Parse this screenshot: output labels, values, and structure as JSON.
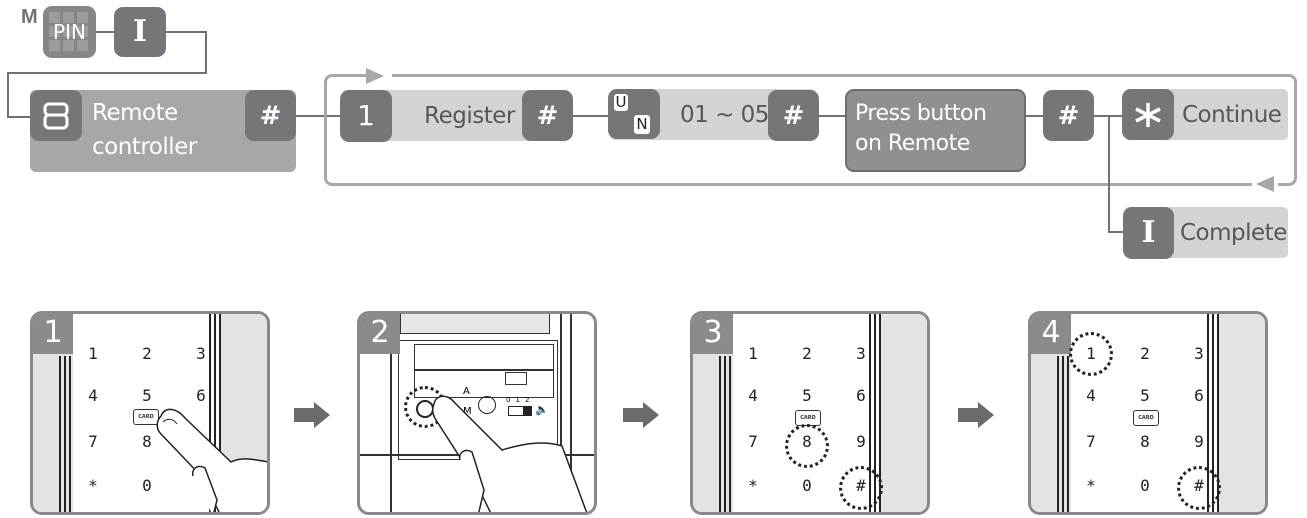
{
  "flow": {
    "mode_label": "M",
    "start_keys": {
      "pin_label": "PIN",
      "confirm_icon": "I"
    },
    "remote_step": {
      "key_label": "8",
      "label_line1": "Remote",
      "label_line2": "controller",
      "confirm_icon": "#"
    },
    "loop_steps": [
      {
        "key_label": "1",
        "label": "Register",
        "confirm_icon": "#"
      },
      {
        "key_top": "U",
        "key_bottom": "N",
        "label": "01 ~ 05",
        "confirm_icon": "#"
      },
      {
        "label_line1": "Press button",
        "label_line2": "on  Remote",
        "confirm_icon": "#"
      }
    ],
    "branches": [
      {
        "key_icon": "*",
        "label": "Continue"
      },
      {
        "key_icon": "I",
        "label": "Complete"
      }
    ]
  },
  "steps": [
    {
      "number": "1",
      "card_label": "CARD"
    },
    {
      "number": "2",
      "switch_labels": [
        "0",
        "1",
        "2"
      ],
      "am_top": "A",
      "am_bottom": "M"
    },
    {
      "number": "3",
      "card_label": "CARD"
    },
    {
      "number": "4",
      "card_label": "CARD"
    }
  ],
  "keypad": {
    "keys": [
      "1",
      "2",
      "3",
      "4",
      "5",
      "6",
      "7",
      "8",
      "9",
      "*",
      "0",
      "#"
    ]
  },
  "colors": {
    "key_dark": "#75767a",
    "strip_light": "#d2d3d5",
    "loop_line": "#a7a8ab"
  }
}
